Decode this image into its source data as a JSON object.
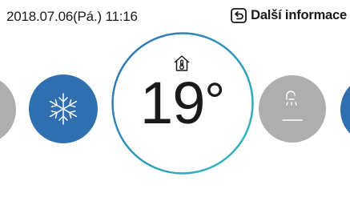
{
  "status_bar": {
    "datetime": "2018.07.06(Pá.)  11:16",
    "info_label": "Další informace",
    "info_icon": "return-icon"
  },
  "dial": {
    "temperature": "19",
    "unit": "°",
    "icon": "thermometer-home-icon",
    "gradient_colors": [
      "#2e6db4",
      "#31bfc0"
    ]
  },
  "modes": [
    {
      "name": "previous-mode",
      "icon": "none",
      "color": "#aeaeae"
    },
    {
      "name": "cooling",
      "icon": "snowflake-icon",
      "color": "#2f6fb0"
    },
    {
      "name": "hot-water",
      "icon": "shower-icon",
      "color": "#aeaeae"
    },
    {
      "name": "next-mode",
      "icon": "none",
      "color": "#2f6fb0"
    }
  ]
}
